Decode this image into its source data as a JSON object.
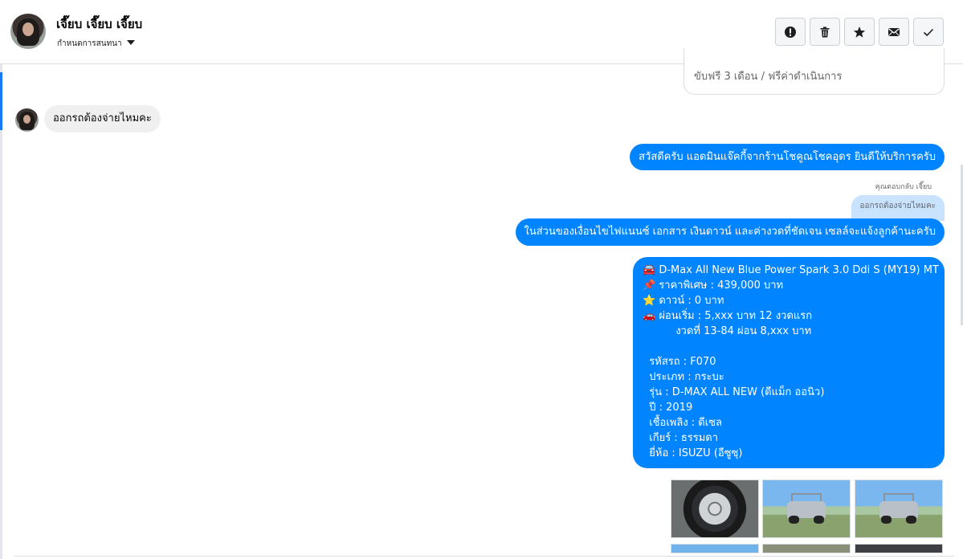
{
  "header": {
    "contact_name": "เจี๊ยบ เจี๊ยบ เจี๊ยบ",
    "conversation_label": "กำหนดการสนทนา",
    "toolbar": [
      {
        "name": "report-button",
        "icon": "alert-circle-icon"
      },
      {
        "name": "delete-button",
        "icon": "trash-icon"
      },
      {
        "name": "star-button",
        "icon": "star-icon"
      },
      {
        "name": "mark-unread-button",
        "icon": "envelope-icon"
      },
      {
        "name": "mark-done-button",
        "icon": "check-icon"
      }
    ]
  },
  "card": {
    "text": "ขับฟรี 3 เดือน / ฟรีค่าดำเนินการ"
  },
  "messages": {
    "incoming_1": "ออกรถต้องจ่ายไหมคะ",
    "outgoing_1": "สวัสดีครับ แอดมินแจ๊คกี้จากร้านโชคูณโชคอุดร ยินดีให้บริการครับ",
    "reply_label": "คุณตอบกลับ เจี๊ยบ",
    "reply_quote": "ออกรถต้องจ่ายไหมคะ",
    "outgoing_2": "ในส่วนของเงื่อนไขไฟแนนซ์ เอกสาร เงินดาวน์ และค่างวดที่ชัดเจน เซลล์จะแจ้งลูกค้านะครับ",
    "car_details": [
      "🚘 D-Max All New Blue Power Spark 3.0 Ddi S (MY19) MT",
      "📌 ราคาพิเศษ : 439,000 บาท",
      "⭐ ดาวน์ : 0 บาท",
      "🚗 ผ่อนเริ่ม : 5,xxx บาท 12 งวดแรก",
      "          งวดที่ 13-84 ผ่อน 8,xxx บาท",
      "",
      "  รหัสรถ : F070",
      "  ประเภท : กระบะ",
      "  รุ่น : D-MAX ALL NEW (ดีแม็ก ออนิว)",
      "  ปี : 2019",
      "  เชื้อเพลิง : ดีเซล",
      "  เกียร์ : ธรรมดา",
      "  ยี่ห้อ : ISUZU (อีซูซุ)"
    ]
  },
  "colors": {
    "outgoing_bubble": "#0084ff",
    "incoming_bubble": "#f0f0f0",
    "reply_quote_bg": "#c9e3ff",
    "accent": "#1877f2"
  }
}
